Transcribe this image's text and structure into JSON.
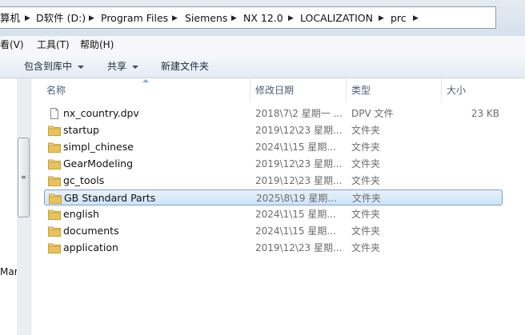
{
  "address": {
    "crumbs": [
      "算机",
      "D软件 (D:)",
      "Program Files",
      "Siemens",
      "NX 12.0",
      "LOCALIZATION",
      "prc"
    ]
  },
  "menu": {
    "view": "看(V)",
    "tools": "工具(T)",
    "help": "帮助(H)"
  },
  "toolbar": {
    "include_library": "包含到库中",
    "share": "共享",
    "new_folder": "新建文件夹"
  },
  "columns": {
    "name": "名称",
    "date": "修改日期",
    "type": "类型",
    "size": "大小"
  },
  "files": [
    {
      "name": "nx_country.dpv",
      "date": "2018\\7\\2 星期一 ...",
      "type": "DPV 文件",
      "size": "23 KB",
      "icon": "file-icon"
    },
    {
      "name": "startup",
      "date": "2019\\12\\23 星期...",
      "type": "文件夹",
      "size": "",
      "icon": "folder-icon"
    },
    {
      "name": "simpl_chinese",
      "date": "2024\\1\\15 星期...",
      "type": "文件夹",
      "size": "",
      "icon": "folder-icon"
    },
    {
      "name": "GearModeling",
      "date": "2019\\12\\23 星期...",
      "type": "文件夹",
      "size": "",
      "icon": "folder-icon"
    },
    {
      "name": "gc_tools",
      "date": "2019\\12\\23 星期...",
      "type": "文件夹",
      "size": "",
      "icon": "folder-icon"
    },
    {
      "name": "GB Standard Parts",
      "date": "2025\\8\\19 星期...",
      "type": "文件夹",
      "size": "",
      "icon": "folder-icon"
    },
    {
      "name": "english",
      "date": "2024\\1\\15 星期...",
      "type": "文件夹",
      "size": "",
      "icon": "folder-icon"
    },
    {
      "name": "documents",
      "date": "2024\\1\\15 星期...",
      "type": "文件夹",
      "size": "",
      "icon": "folder-icon"
    },
    {
      "name": "application",
      "date": "2019\\12\\23 星期...",
      "type": "文件夹",
      "size": "",
      "icon": "folder-icon"
    }
  ],
  "selected_index": 5,
  "nav": {
    "partial_item": "Mar"
  },
  "colors": {
    "selection_border": "#7da2ce",
    "selection_fill": "#cfe4fa",
    "folder": "#e8c25a"
  }
}
